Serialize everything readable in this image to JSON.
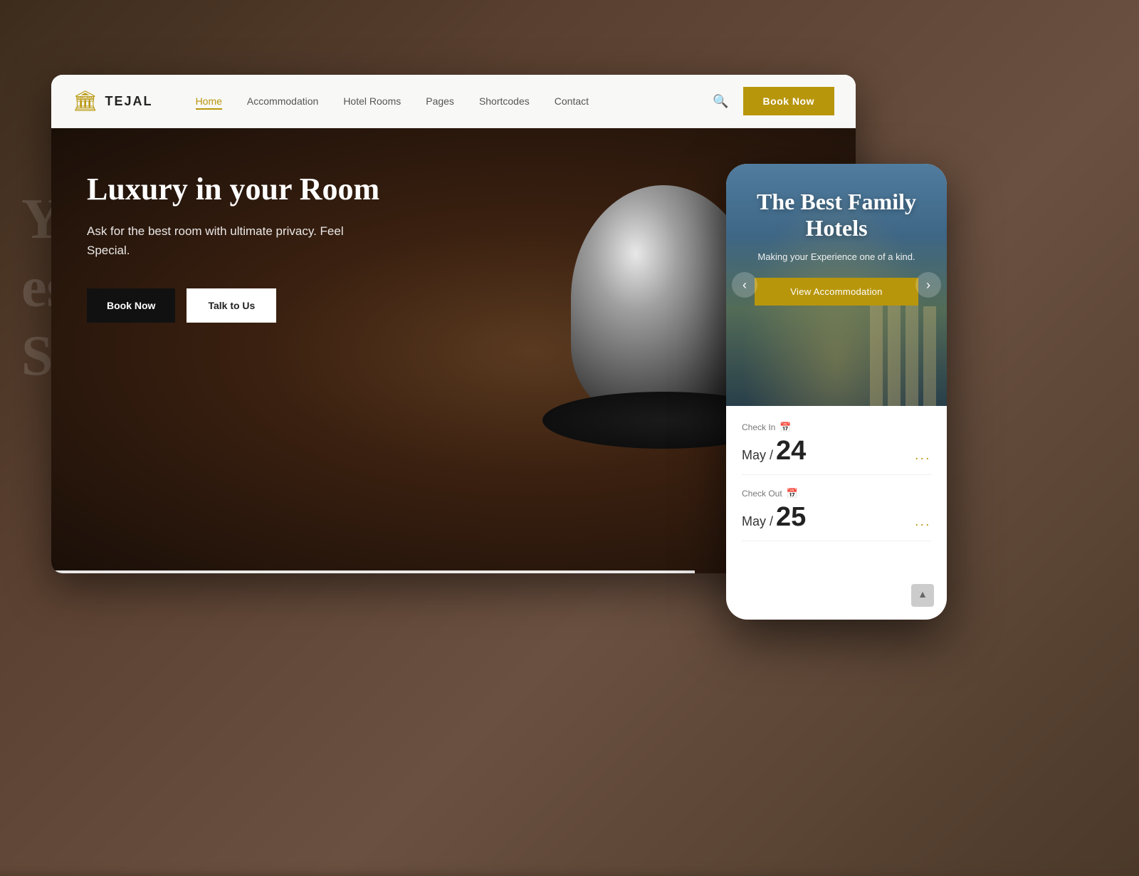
{
  "brand": {
    "logo_text": "TEJAL",
    "logo_icon": "🏛"
  },
  "nav": {
    "links": [
      {
        "label": "Home",
        "active": true
      },
      {
        "label": "Accommodation",
        "active": false
      },
      {
        "label": "Hotel Rooms",
        "active": false
      },
      {
        "label": "Pages",
        "active": false
      },
      {
        "label": "Shortcodes",
        "active": false
      },
      {
        "label": "Contact",
        "active": false
      }
    ],
    "book_now": "Book Now"
  },
  "hero": {
    "title": "Luxury in your Room",
    "subtitle": "Ask for the best room with ultimate privacy. Feel Special.",
    "btn_book": "Book Now",
    "btn_talk": "Talk to Us"
  },
  "mobile": {
    "hero_title": "The Best Family Hotels",
    "hero_subtitle": "Making your Experience one of a kind.",
    "view_btn": "View Accommodation",
    "checkin_label": "Check In",
    "checkin_month": "May /",
    "checkin_day": "24",
    "checkout_label": "Check Out",
    "checkout_month": "May /",
    "checkout_day": "25",
    "dots": "...",
    "calendar_icon": "📅"
  },
  "colors": {
    "gold": "#b8960c",
    "dark": "#111111",
    "white": "#ffffff"
  }
}
